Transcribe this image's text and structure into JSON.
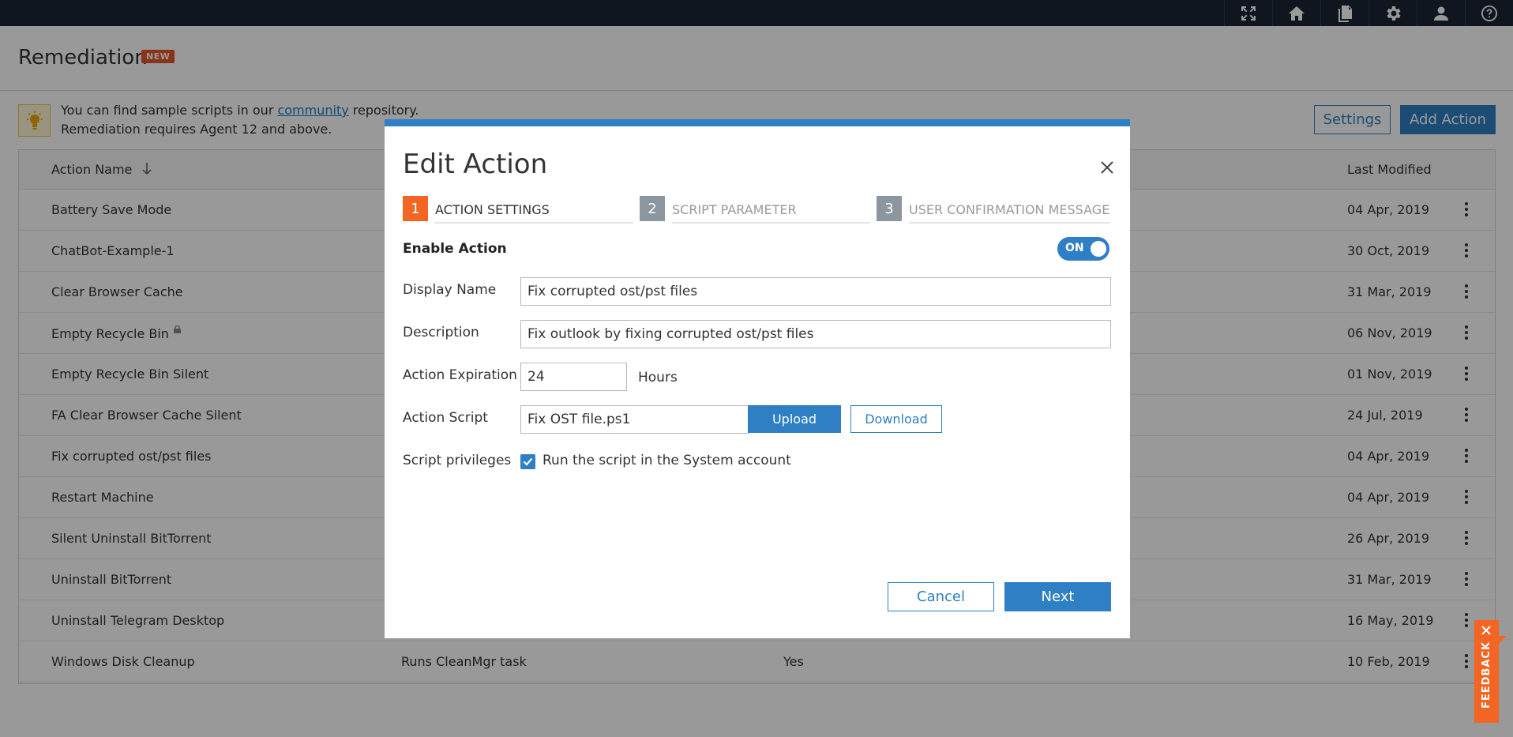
{
  "topbar": {
    "icons": [
      "fullscreen-icon",
      "home-icon",
      "documents-icon",
      "gear-icon",
      "user-icon",
      "help-icon"
    ]
  },
  "page": {
    "title": "Remediation",
    "badge": "NEW"
  },
  "info": {
    "line1_prefix": "You can find sample scripts in our ",
    "line1_link": "community",
    "line1_suffix": " repository.",
    "line2": "Remediation requires Agent 12 and above."
  },
  "toolbar": {
    "settings_label": "Settings",
    "add_action_label": "Add Action"
  },
  "table": {
    "columns": {
      "action_name": "Action Name",
      "last_modified": "Last Modified"
    },
    "rows": [
      {
        "name": "Battery Save Mode",
        "description": "",
        "flag": "",
        "modified": "04 Apr, 2019",
        "locked": false
      },
      {
        "name": "ChatBot-Example-1",
        "description": "",
        "flag": "",
        "modified": "30 Oct, 2019",
        "locked": false
      },
      {
        "name": "Clear Browser Cache",
        "description": "",
        "flag": "",
        "modified": "31 Mar, 2019",
        "locked": false
      },
      {
        "name": "Empty Recycle Bin",
        "description": "",
        "flag": "",
        "modified": "06 Nov, 2019",
        "locked": true
      },
      {
        "name": "Empty Recycle Bin Silent",
        "description": "",
        "flag": "",
        "modified": "01 Nov, 2019",
        "locked": false
      },
      {
        "name": "FA Clear Browser Cache Silent",
        "description": "",
        "flag": "",
        "modified": "24 Jul, 2019",
        "locked": false
      },
      {
        "name": "Fix corrupted ost/pst files",
        "description": "",
        "flag": "",
        "modified": "04 Apr, 2019",
        "locked": false
      },
      {
        "name": "Restart Machine",
        "description": "",
        "flag": "",
        "modified": "04 Apr, 2019",
        "locked": false
      },
      {
        "name": "Silent Uninstall BitTorrent",
        "description": "",
        "flag": "",
        "modified": "26 Apr, 2019",
        "locked": false
      },
      {
        "name": "Uninstall BitTorrent",
        "description": "",
        "flag": "",
        "modified": "31 Mar, 2019",
        "locked": false
      },
      {
        "name": "Uninstall Telegram Desktop",
        "description": "",
        "flag": "",
        "modified": "16 May, 2019",
        "locked": false
      },
      {
        "name": "Windows Disk Cleanup",
        "description": "Runs CleanMgr task",
        "flag": "Yes",
        "modified": "10 Feb, 2019",
        "locked": false
      }
    ]
  },
  "modal": {
    "title": "Edit Action",
    "steps": [
      {
        "num": "1",
        "label": "ACTION SETTINGS",
        "active": true
      },
      {
        "num": "2",
        "label": "SCRIPT PARAMETER",
        "active": false
      },
      {
        "num": "3",
        "label": "USER CONFIRMATION MESSAGE",
        "active": false
      }
    ],
    "enable_label": "Enable Action",
    "toggle_text": "ON",
    "display_name_label": "Display Name",
    "display_name_value": "Fix corrupted ost/pst files",
    "description_label": "Description",
    "description_value": "Fix outlook by fixing corrupted ost/pst files",
    "expiration_label": "Action Expiration",
    "expiration_value": "24",
    "expiration_unit": "Hours",
    "script_label": "Action Script",
    "script_value": "Fix OST file.ps1",
    "upload_label": "Upload",
    "download_label": "Download",
    "privileges_label": "Script privileges",
    "privileges_checkbox_label": "Run the script in the System account",
    "privileges_checked": true,
    "cancel_label": "Cancel",
    "next_label": "Next"
  },
  "feedback": {
    "label": "FEEDBACK"
  },
  "colors": {
    "topbar": "#1c2635",
    "accent": "#2e7fc4",
    "step_active": "#f26522",
    "step_inactive": "#8c969e",
    "badge": "#e8562a"
  }
}
